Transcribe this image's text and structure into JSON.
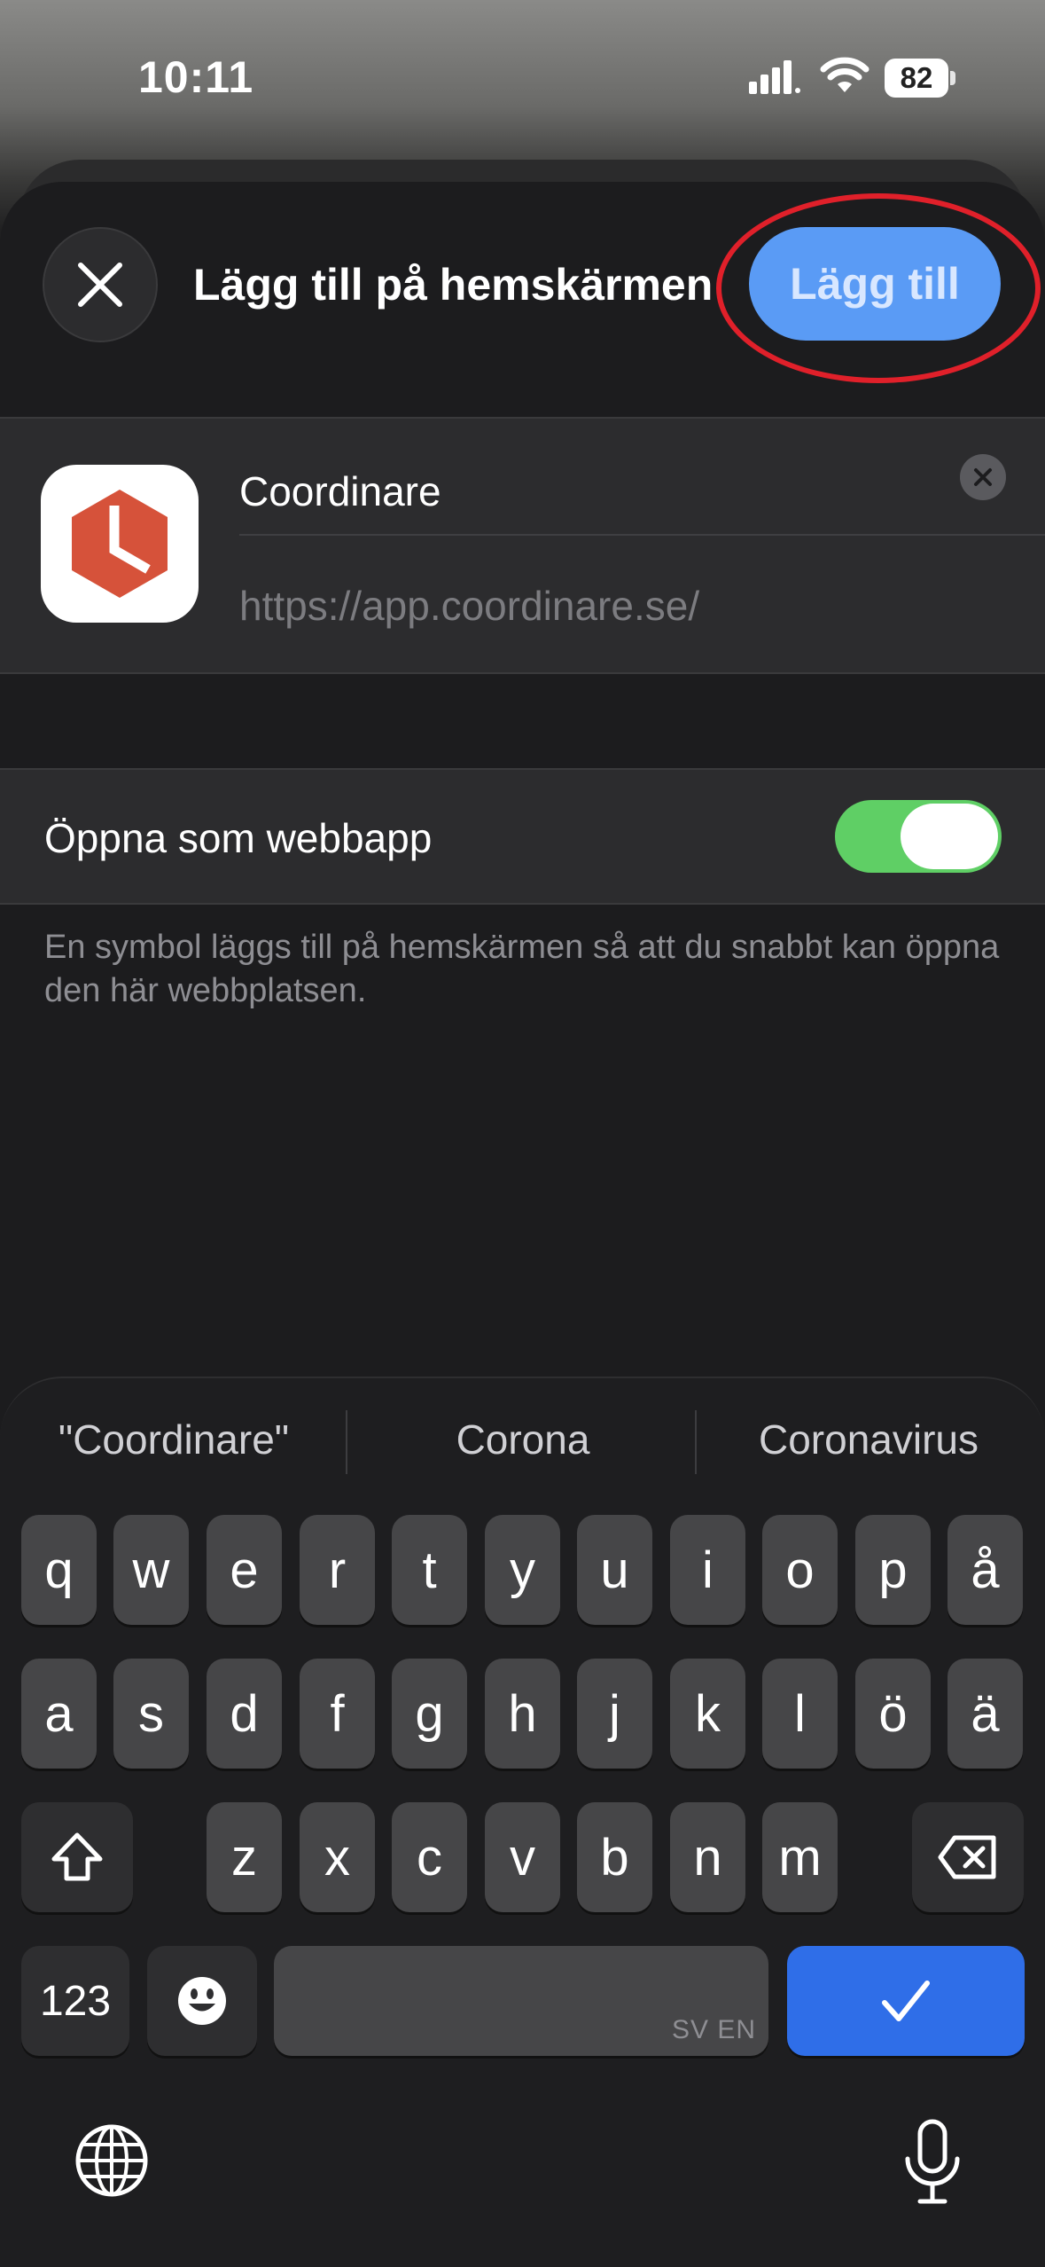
{
  "status_bar": {
    "time": "10:11",
    "battery": "82"
  },
  "header": {
    "title": "Lägg till på hemskärmen",
    "add_label": "Lägg till",
    "close_icon": "close-icon"
  },
  "bookmark": {
    "name_value": "Coordinare",
    "url": "https://app.coordinare.se/",
    "icon_color": "#d6523a"
  },
  "web_app": {
    "label": "Öppna som webbapp",
    "enabled": true,
    "footnote": "En symbol läggs till på hemskärmen så att du snabbt kan öppna den här webbplatsen."
  },
  "keyboard": {
    "suggestions": [
      "\"Coordinare\"",
      "Corona",
      "Coronavirus"
    ],
    "row1": [
      "q",
      "w",
      "e",
      "r",
      "t",
      "y",
      "u",
      "i",
      "o",
      "p",
      "å"
    ],
    "row2": [
      "a",
      "s",
      "d",
      "f",
      "g",
      "h",
      "j",
      "k",
      "l",
      "ö",
      "ä"
    ],
    "row3": [
      "z",
      "x",
      "c",
      "v",
      "b",
      "n",
      "m"
    ],
    "numbers_label": "123",
    "space_languages": "SV EN",
    "accent": "#2f6ee8"
  },
  "colors": {
    "toggle_on": "#5fcf65",
    "add_button": "#5a9bf5",
    "annotation": "#e0202a"
  }
}
